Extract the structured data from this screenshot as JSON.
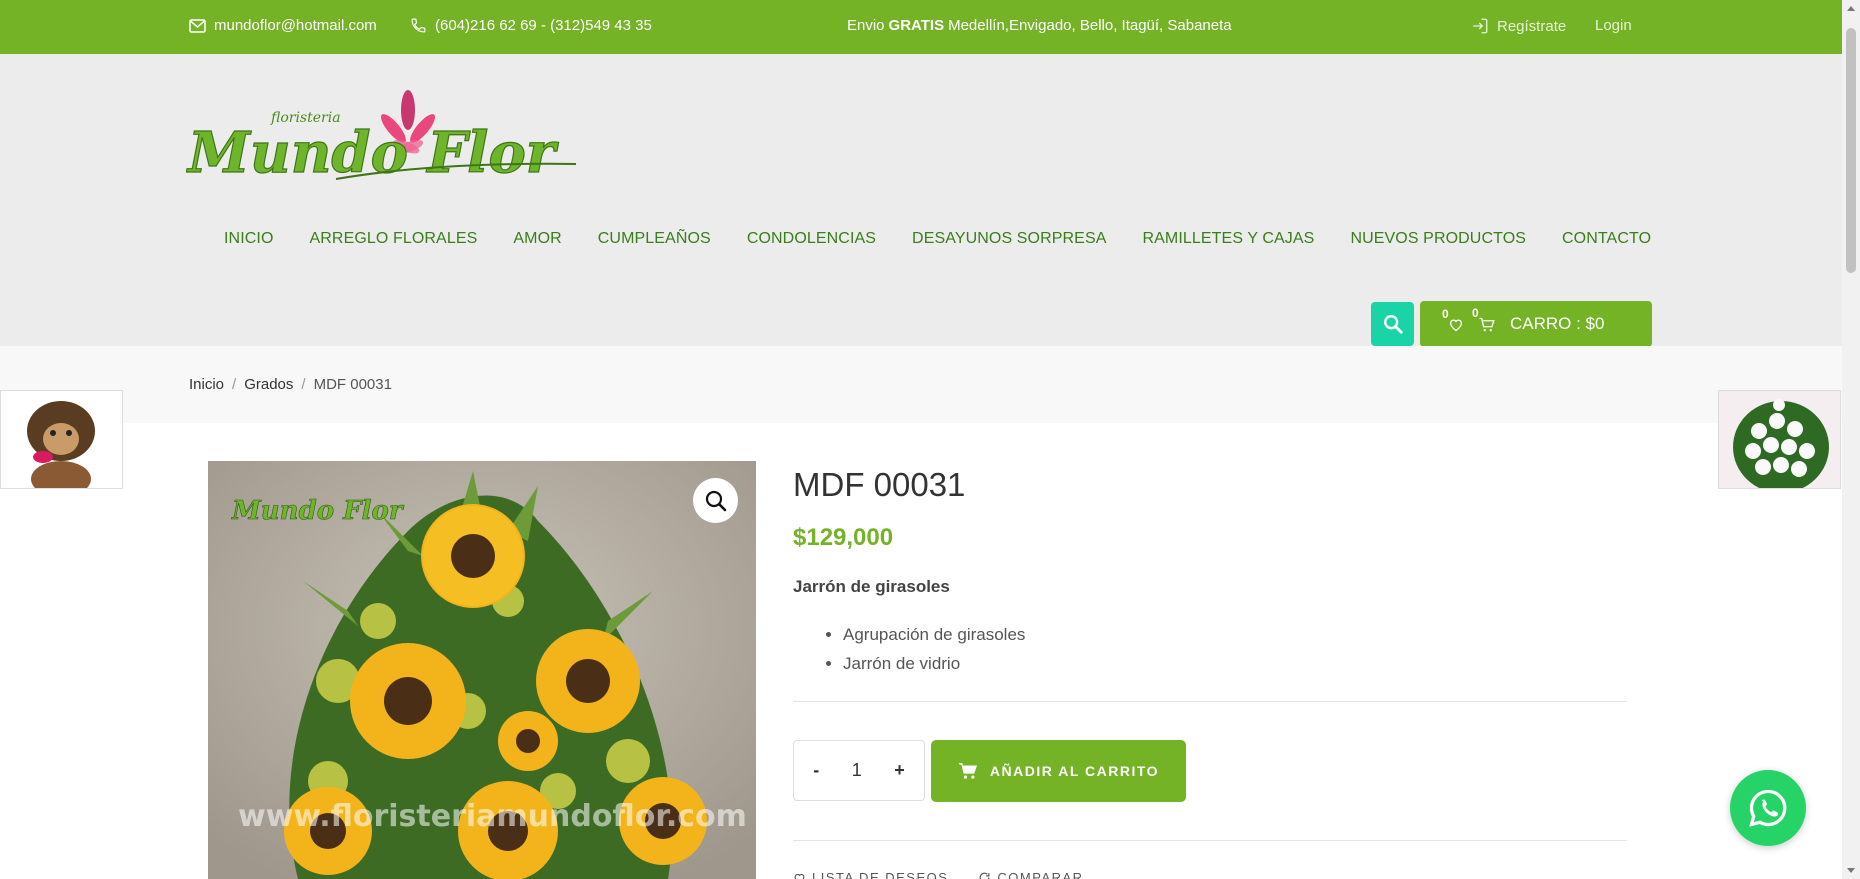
{
  "topbar": {
    "email": "mundoflor@hotmail.com",
    "phone": "(604)216 62 69 - (312)549 43 35",
    "shipping_prefix": "Envio",
    "shipping_bold": "GRATIS",
    "shipping_suffix": "Medellín,Envigado, Bello, Itagüí, Sabaneta",
    "register": "Regístrate",
    "login": "Login"
  },
  "logo": {
    "small_text": "floristeria",
    "text": "Mundo Flor"
  },
  "nav": {
    "items": [
      "INICIO",
      "ARREGLO FLORALES",
      "AMOR",
      "CUMPLEAÑOS",
      "CONDOLENCIAS",
      "DESAYUNOS SORPRESA",
      "RAMILLETES Y CAJAS",
      "NUEVOS PRODUCTOS",
      "CONTACTO"
    ]
  },
  "cart": {
    "wishlist_count": "0",
    "cart_count": "0",
    "label": "CARRO : $0"
  },
  "breadcrumb": {
    "home": "Inicio",
    "category": "Grados",
    "current": "MDF 00031"
  },
  "product": {
    "title": "MDF 00031",
    "price": "$129,000",
    "short_description": "Jarrón de girasoles",
    "features": [
      "Agrupación de girasoles",
      "Jarrón de vidrio"
    ],
    "quantity": "1",
    "qty_minus": "-",
    "qty_plus": "+",
    "add_to_cart": "AÑADIR AL CARRITO",
    "image_watermark_logo": "Mundo Flor",
    "image_watermark_url": "www.floristeriamundoflor.com"
  },
  "actions": {
    "wishlist": "LISTA DE DESEOS",
    "compare": "COMPARAR"
  },
  "colors": {
    "brand_green": "#74b226",
    "search_teal": "#1ad4a8",
    "whatsapp": "#25d366"
  }
}
